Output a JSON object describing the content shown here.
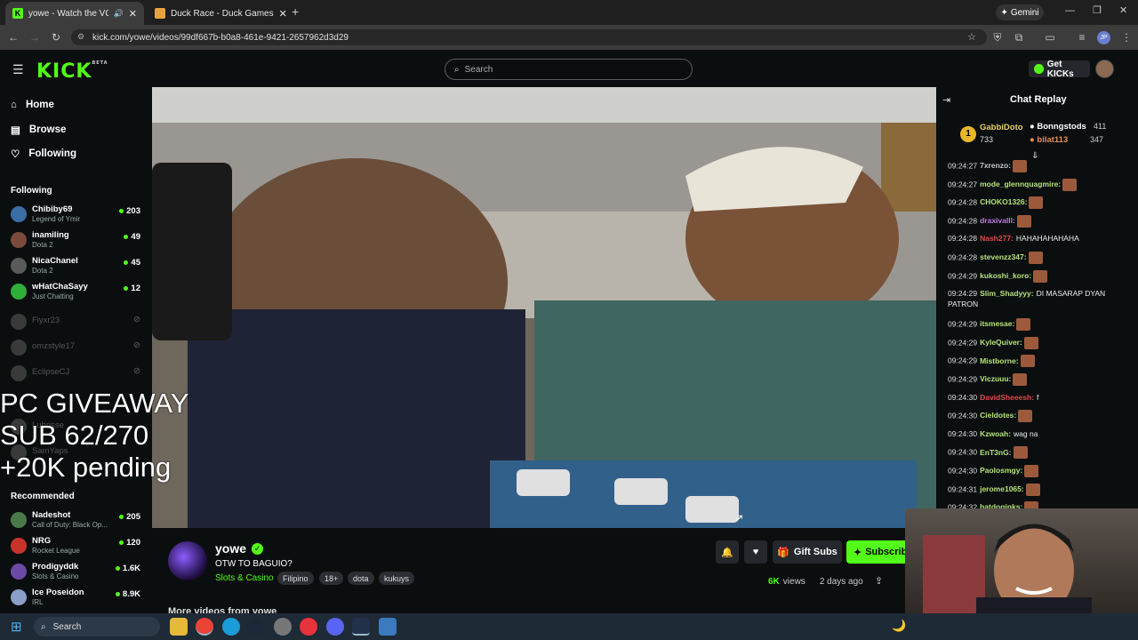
{
  "browser": {
    "tabs": [
      {
        "title": "yowe - Watch the VOD on K"
      },
      {
        "title": "Duck Race - Duck Games"
      }
    ],
    "gemini_label": "Gemini",
    "url": "kick.com/yowe/videos/99df667b-b0a8-461e-9421-2657962d3d29",
    "profile_initials": "JP"
  },
  "kick": {
    "logo": "KICK",
    "logo_badge": "BETA",
    "search_placeholder": "Search",
    "get_kicks": "Get KICKs",
    "nav": [
      {
        "label": "Home",
        "icon": "home-icon"
      },
      {
        "label": "Browse",
        "icon": "browse-icon"
      },
      {
        "label": "Following",
        "icon": "heart-icon"
      }
    ],
    "following_header": "Following",
    "following": [
      {
        "name": "Chibiby69",
        "game": "Legend of Ymir",
        "viewers": "203",
        "color": "#3a6ea5"
      },
      {
        "name": "inamiling",
        "game": "Dota 2",
        "viewers": "49",
        "color": "#7a4a3a"
      },
      {
        "name": "NicaChanel",
        "game": "Dota 2",
        "viewers": "45",
        "color": "#5a5a5a"
      },
      {
        "name": "wHatChaSayy",
        "game": "Just Chatting",
        "viewers": "12",
        "color": "#2fae3a"
      }
    ],
    "offline": [
      {
        "name": "Flyxr23"
      },
      {
        "name": "omzstyle17"
      },
      {
        "name": "EclipseCJ"
      },
      {
        "name": "Lubrisse"
      },
      {
        "name": "SamYaps"
      }
    ],
    "recommended_header": "Recommended",
    "recommended": [
      {
        "name": "Nadeshot",
        "game": "Call of Duty: Black Op...",
        "viewers": "205",
        "color": "#4a7a4a"
      },
      {
        "name": "NRG",
        "game": "Rocket League",
        "viewers": "120",
        "color": "#c8342c"
      },
      {
        "name": "Prodigyddk",
        "game": "Slots & Casino",
        "viewers": "1.6K",
        "color": "#6a4aa5"
      },
      {
        "name": "Ice Poseidon",
        "game": "IRL",
        "viewers": "8.9K",
        "color": "#8aa0c8"
      }
    ],
    "overlay_lines": [
      "PC GIVEAWAY",
      "SUB 62/270",
      "+20K pending"
    ],
    "streamer": {
      "name": "yowe",
      "title": "OTW TO BAGUIO?",
      "category": "Slots & Casino",
      "tags": [
        "Filipino",
        "18+",
        "dota",
        "kukuys"
      ],
      "views_count": "6K",
      "views_label": "views",
      "age": "2 days ago",
      "gift_subs": "Gift Subs",
      "subscribe": "Subscribe",
      "more_videos": "More videos from yowe"
    },
    "chat": {
      "title": "Chat Replay",
      "leaderboard": [
        {
          "rank": "1",
          "name": "GabbiDoto",
          "value": "733"
        },
        {
          "name": "Bonngstods",
          "value": "411"
        },
        {
          "name": "bilat113",
          "value": "347"
        }
      ],
      "messages": [
        {
          "time": "09:24:27",
          "user": "7xrenzo:",
          "color": "#c8c8c8",
          "text": ""
        },
        {
          "time": "09:24:27",
          "user": "mode_glennquagmire:",
          "color": "#b5e37a",
          "text": ""
        },
        {
          "time": "09:24:28",
          "user": "CHOKO1326:",
          "color": "#b5e37a",
          "text": ""
        },
        {
          "time": "09:24:28",
          "user": "draxivalll:",
          "color": "#c07ae3",
          "text": ""
        },
        {
          "time": "09:24:28",
          "user": "Nash277:",
          "color": "#e34a4a",
          "text": "HAHAHAHAHAHA"
        },
        {
          "time": "09:24:28",
          "user": "stevenzz347:",
          "color": "#b5e37a",
          "text": ""
        },
        {
          "time": "09:24:29",
          "user": "kukoshi_koro:",
          "color": "#b5e37a",
          "text": ""
        },
        {
          "time": "09:24:29",
          "user": "Slim_Shadyyy:",
          "color": "#b5e37a",
          "text": "DI MASARAP DYAN PATRON"
        },
        {
          "time": "09:24:29",
          "user": "itsmesae:",
          "color": "#b5e37a",
          "text": ""
        },
        {
          "time": "09:24:29",
          "user": "KyleQuiver:",
          "color": "#b5e37a",
          "text": ""
        },
        {
          "time": "09:24:29",
          "user": "Mistborne:",
          "color": "#b5e37a",
          "text": ""
        },
        {
          "time": "09:24:29",
          "user": "Viczuuu:",
          "color": "#b5e37a",
          "text": ""
        },
        {
          "time": "09:24:30",
          "user": "DavidSheeesh:",
          "color": "#e34a4a",
          "text": "f"
        },
        {
          "time": "09:24:30",
          "user": "Cieldotes:",
          "color": "#b5e37a",
          "text": ""
        },
        {
          "time": "09:24:30",
          "user": "Kzwoah:",
          "color": "#b5e37a",
          "text": "wag na"
        },
        {
          "time": "09:24:30",
          "user": "EnT3nG:",
          "color": "#b5e37a",
          "text": ""
        },
        {
          "time": "09:24:30",
          "user": "Paolosmgy:",
          "color": "#b5e37a",
          "text": ""
        },
        {
          "time": "09:24:31",
          "user": "jerome1065:",
          "color": "#b5e37a",
          "text": ""
        },
        {
          "time": "09:24:32",
          "user": "hatdogjnks:",
          "color": "#b5e37a",
          "text": ""
        }
      ]
    }
  },
  "taskbar": {
    "search_label": "Search"
  },
  "colors": {
    "kick_green": "#53fc18",
    "bg": "#0b0e0f"
  }
}
